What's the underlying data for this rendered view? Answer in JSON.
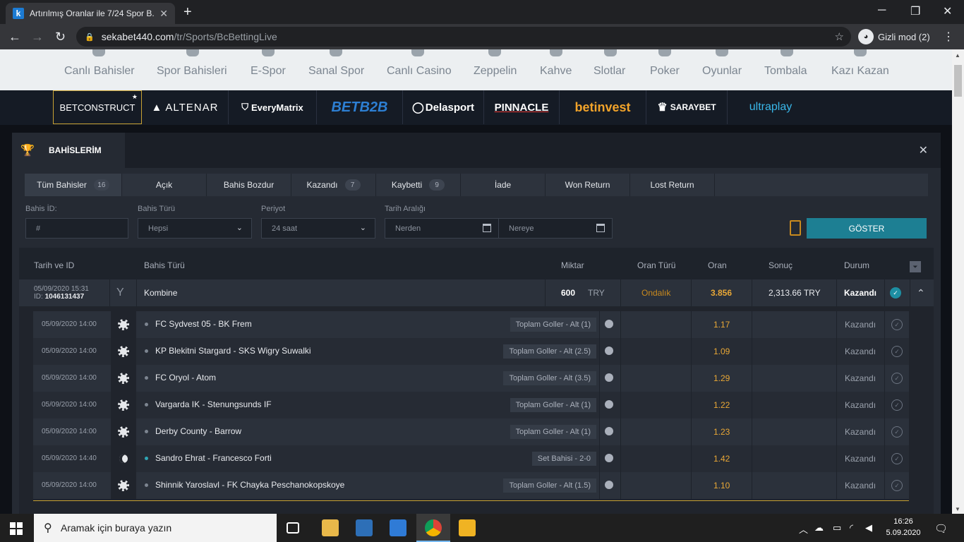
{
  "browser": {
    "tab_title": "Artırılmış Oranlar ile 7/24 Spor B...",
    "favicon": "k",
    "url_host": "sekabet440.com",
    "url_path": "/tr/Sports/BcBettingLive",
    "incognito_label": "Gizli mod (2)"
  },
  "site_nav": [
    "Canlı Bahisler",
    "Spor Bahisleri",
    "E-Spor",
    "Sanal Spor",
    "Canlı Casino",
    "Zeppelin",
    "Kahve",
    "Slotlar",
    "Poker",
    "Oyunlar",
    "Tombala",
    "Kazı Kazan"
  ],
  "providers": [
    "BETCONSTRUCT",
    "ALTENAR",
    "EveryMatrix",
    "BETB2B",
    "Delasport",
    "PINNACLE",
    "betinvest",
    "SARAYBET",
    "ultraplay"
  ],
  "modal": {
    "title": "BAHİSLERİM",
    "tabs": [
      {
        "label": "Tüm Bahisler",
        "count": "16"
      },
      {
        "label": "Açık",
        "count": ""
      },
      {
        "label": "Bahis Bozdur",
        "count": ""
      },
      {
        "label": "Kazandı",
        "count": "7"
      },
      {
        "label": "Kaybetti",
        "count": "9"
      },
      {
        "label": "İade",
        "count": ""
      },
      {
        "label": "Won Return",
        "count": ""
      },
      {
        "label": "Lost Return",
        "count": ""
      }
    ],
    "filters": {
      "bet_id_label": "Bahis İD:",
      "bet_id_placeholder": "#",
      "bet_type_label": "Bahis Türü",
      "bet_type_value": "Hepsi",
      "period_label": "Periyot",
      "period_value": "24 saat",
      "date_range_label": "Tarih Aralığı",
      "from_placeholder": "Nerden",
      "to_placeholder": "Nereye",
      "show_button": "GÖSTER"
    },
    "columns": [
      "Tarih ve ID",
      "Bahis Türü",
      "Miktar",
      "Oran Türü",
      "Oran",
      "Sonuç",
      "Durum"
    ],
    "bet": {
      "date": "05/09/2020 15:31",
      "id_label": "ID:",
      "id": "1046131437",
      "type": "Kombine",
      "amount": "600",
      "currency": "TRY",
      "odds_type": "Ondalık",
      "odds": "3.856",
      "result": "2,313.66 TRY",
      "status": "Kazandı"
    },
    "selections": [
      {
        "date": "05/09/2020 14:00",
        "sport": "football",
        "match": "FC Sydvest 05 - BK Frem",
        "market": "Toplam Goller - Alt (1)",
        "odds": "1.17",
        "status": "Kazandı"
      },
      {
        "date": "05/09/2020 14:00",
        "sport": "football",
        "match": "KP Blekitni Stargard - SKS Wigry Suwalki",
        "market": "Toplam Goller - Alt (2.5)",
        "odds": "1.09",
        "status": "Kazandı"
      },
      {
        "date": "05/09/2020 14:00",
        "sport": "football",
        "match": "FC Oryol - Atom",
        "market": "Toplam Goller - Alt (3.5)",
        "odds": "1.29",
        "status": "Kazandı"
      },
      {
        "date": "05/09/2020 14:00",
        "sport": "football",
        "match": "Vargarda IK - Stenungsunds IF",
        "market": "Toplam Goller - Alt (1)",
        "odds": "1.22",
        "status": "Kazandı"
      },
      {
        "date": "05/09/2020 14:00",
        "sport": "football",
        "match": "Derby County - Barrow",
        "market": "Toplam Goller - Alt (1)",
        "odds": "1.23",
        "status": "Kazandı"
      },
      {
        "date": "05/09/2020 14:40",
        "sport": "tennis",
        "match": "Sandro Ehrat - Francesco Forti",
        "market": "Set Bahisi - 2-0",
        "odds": "1.42",
        "status": "Kazandı"
      },
      {
        "date": "05/09/2020 14:00",
        "sport": "football",
        "match": "Shinnik Yaroslavl - FK Chayka Peschanokopskoye",
        "market": "Toplam Goller - Alt (1.5)",
        "odds": "1.10",
        "status": "Kazandı"
      }
    ]
  },
  "taskbar": {
    "search_placeholder": "Aramak için buraya yazın",
    "time": "16:26",
    "date": "5.09.2020"
  },
  "colors": {
    "accent_odds": "#e8a736",
    "accent_button": "#1d7f93",
    "odds_type": "#c98a1e"
  }
}
